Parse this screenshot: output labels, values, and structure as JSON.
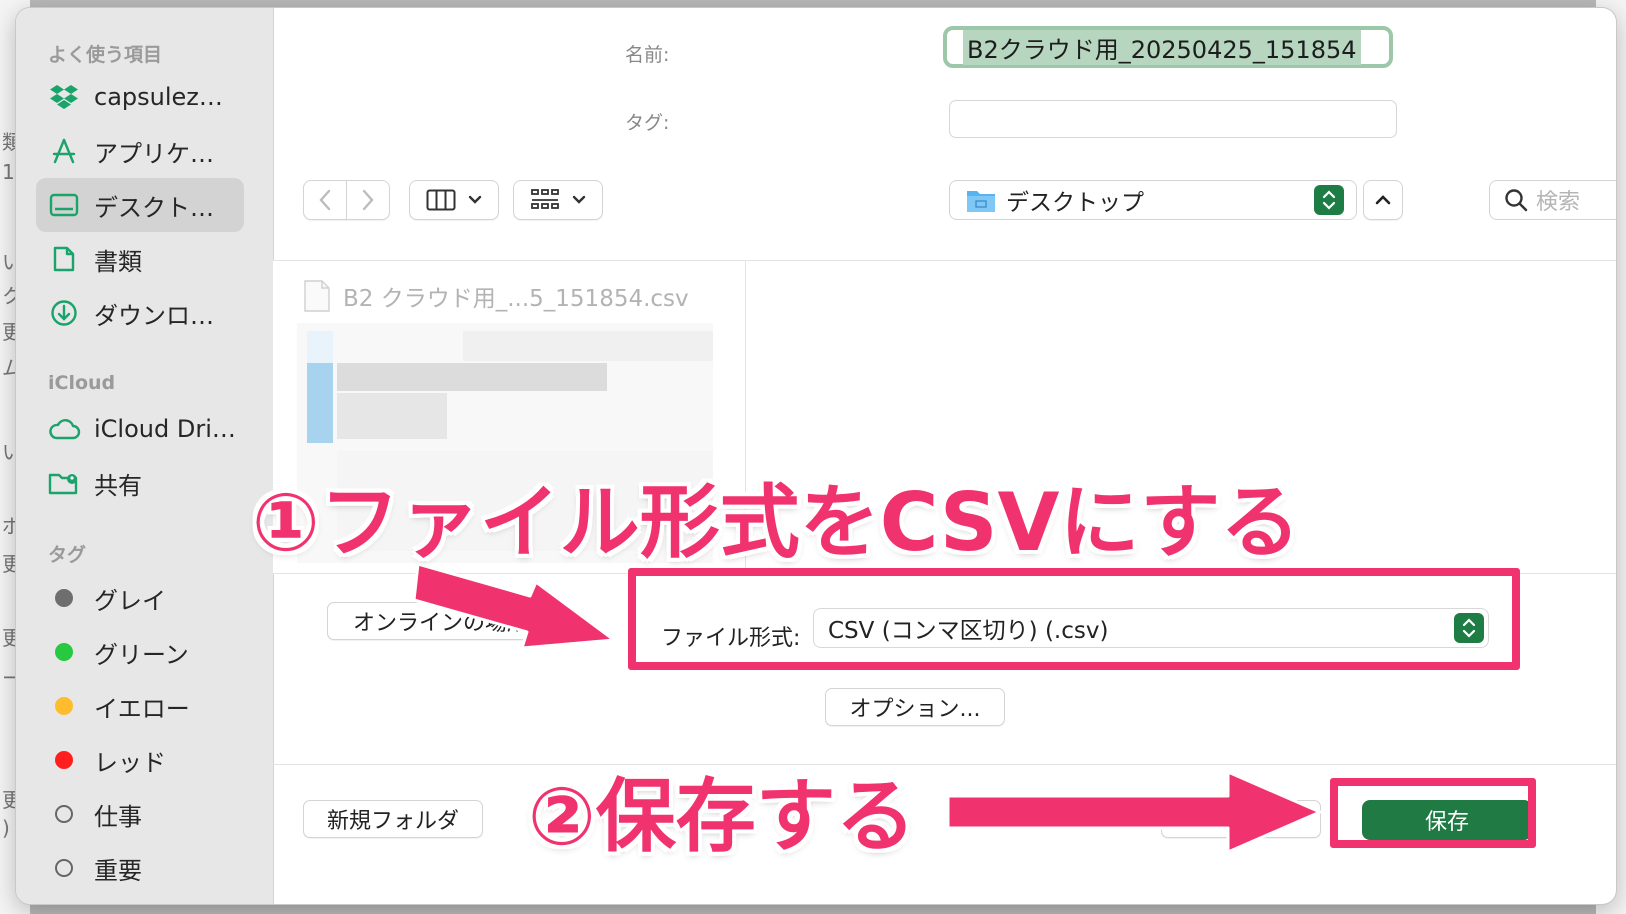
{
  "sidebar": {
    "favorites_heading": "よく使う項目",
    "favorites": [
      {
        "label": "capsulez…",
        "icon": "dropbox-icon"
      },
      {
        "label": "アプリケ…",
        "icon": "applications-icon"
      },
      {
        "label": "デスクト…",
        "icon": "desktop-icon",
        "selected": true
      },
      {
        "label": "書類",
        "icon": "document-icon"
      },
      {
        "label": "ダウンロ…",
        "icon": "download-icon"
      }
    ],
    "icloud_heading": "iCloud",
    "icloud": [
      {
        "label": "iCloud Dri…",
        "icon": "cloud-icon"
      },
      {
        "label": "共有",
        "icon": "shared-folder-icon"
      }
    ],
    "tags_heading": "タグ",
    "tags": [
      {
        "label": "グレイ",
        "color": "#6e6e6e"
      },
      {
        "label": "グリーン",
        "color": "#28c840"
      },
      {
        "label": "イエロー",
        "color": "#febc2e"
      },
      {
        "label": "レッド",
        "color": "#ff1f1f"
      },
      {
        "label": "仕事",
        "color": ""
      },
      {
        "label": "重要",
        "color": ""
      }
    ]
  },
  "form": {
    "name_label": "名前:",
    "name_value": "B2クラウド用_20250425_151854",
    "tag_label": "タグ:",
    "tag_value": ""
  },
  "toolbar": {
    "location": "デスクトップ",
    "search_placeholder": "検索"
  },
  "browser": {
    "file_name": "B2 クラウド用_...5_151854.csv",
    "file_badge": "csv"
  },
  "options": {
    "online_button": "オンラインの場所",
    "format_label": "ファイル形式:",
    "format_value": "CSV (コンマ区切り) (.csv)",
    "options_button": "オプション..."
  },
  "footer": {
    "new_folder_button": "新規フォルダ",
    "save_button": "保存"
  },
  "annotations": {
    "step1": "①ファイル形式をCSVにする",
    "step2": "②保存する",
    "highlight_color": "#f0336e"
  },
  "background_chars": [
    "類",
    "1",
    "い",
    "ク",
    "更",
    "ム",
    "い",
    "ポ",
    "更",
    "更",
    "ー",
    "更",
    ")"
  ]
}
